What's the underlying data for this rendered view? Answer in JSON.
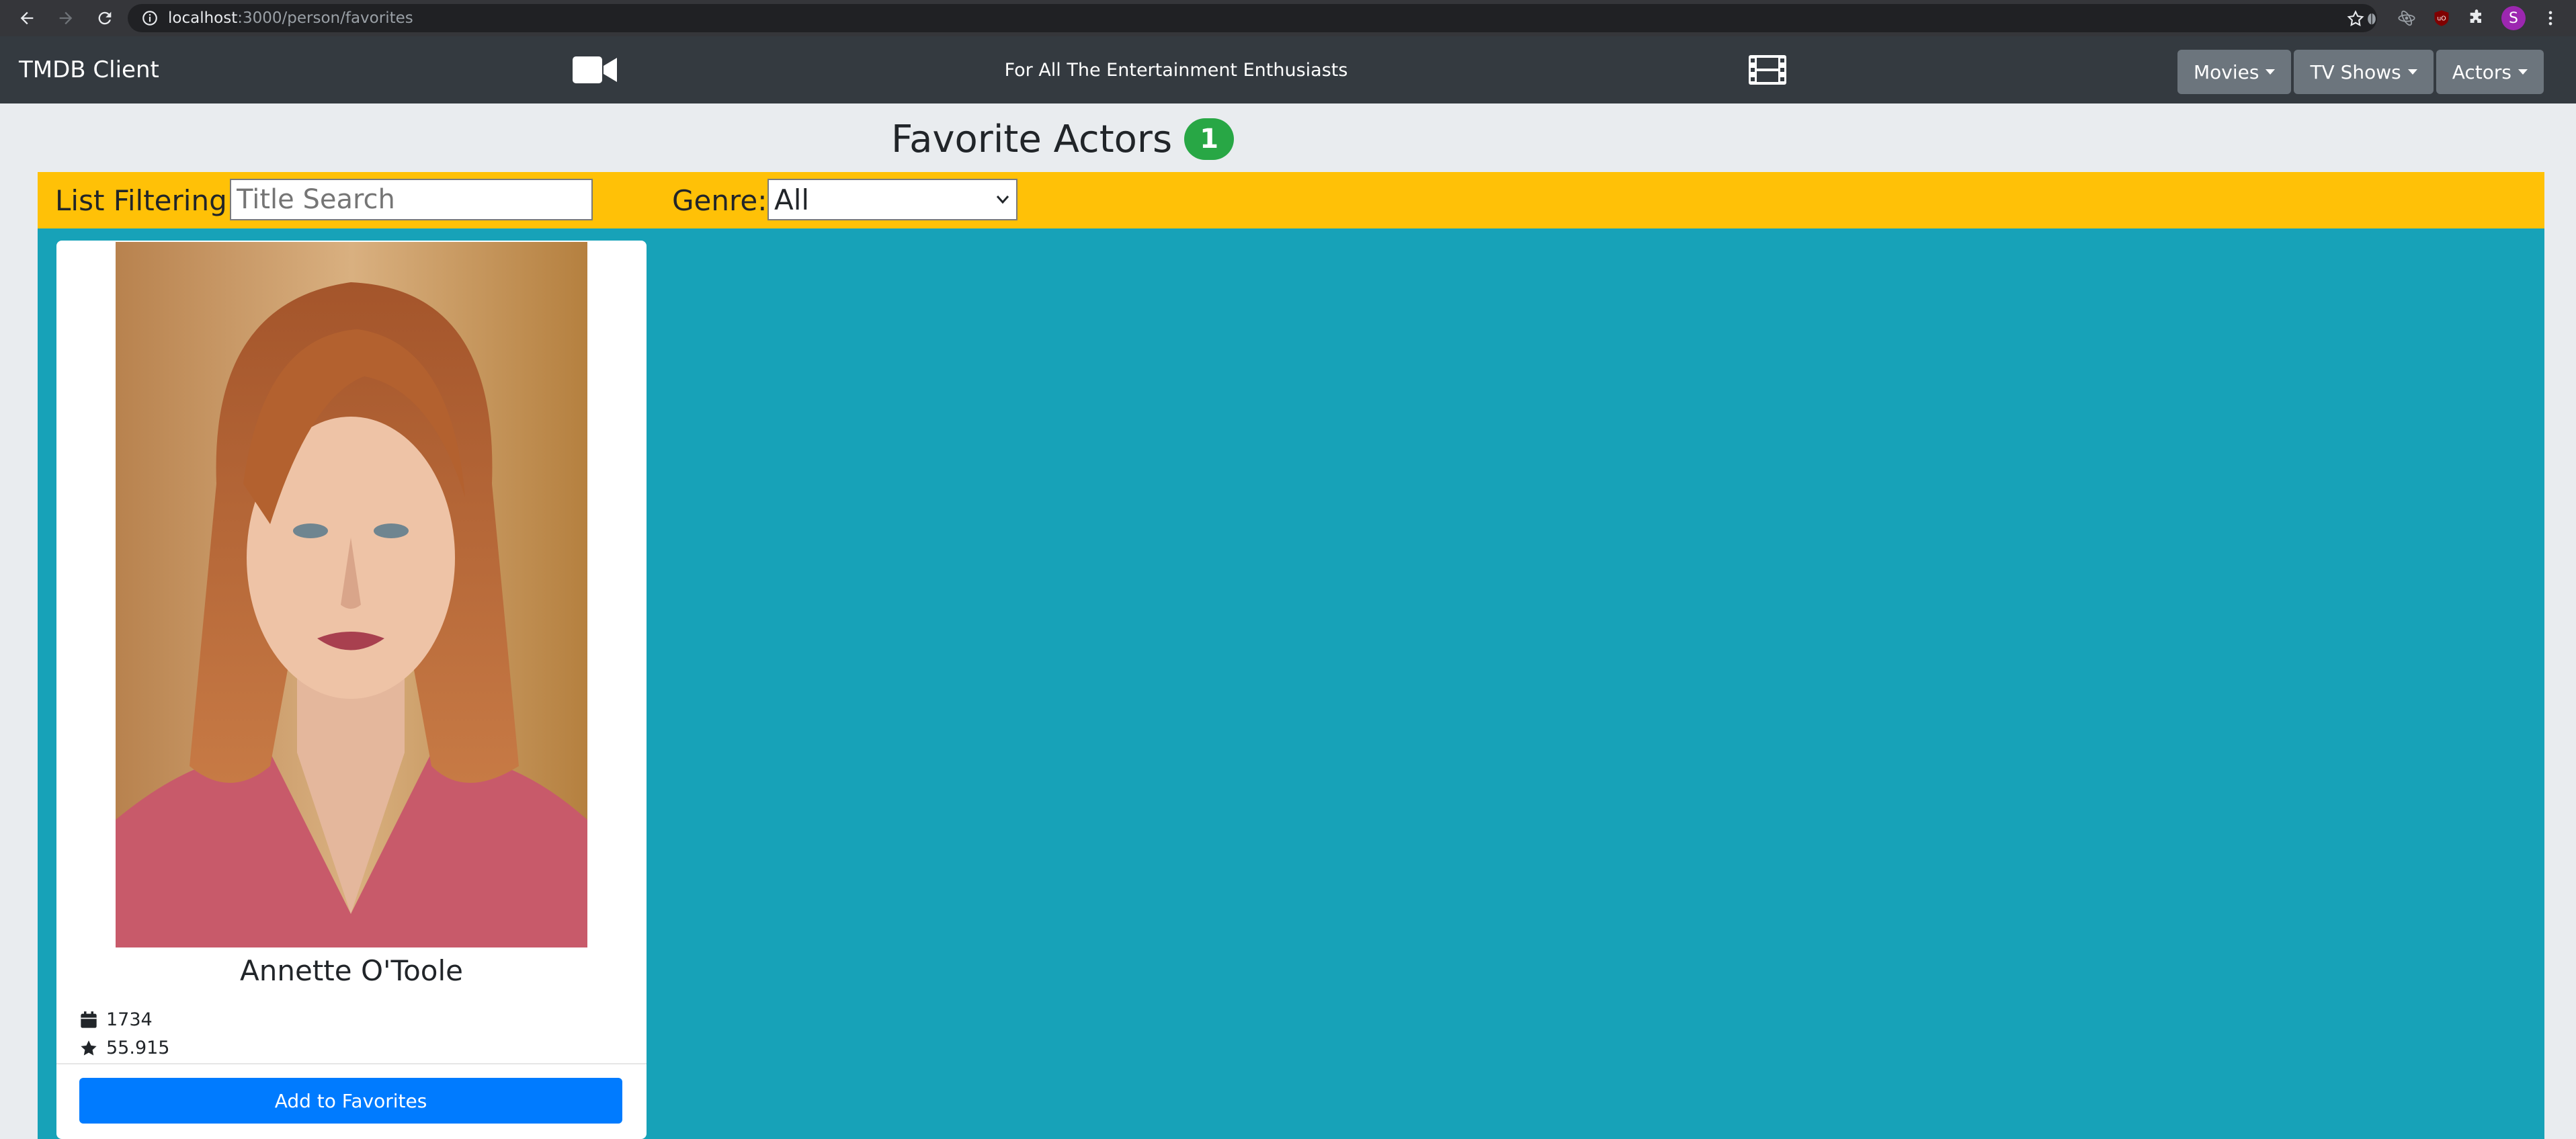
{
  "browser": {
    "url_host": "localhost",
    "url_path": ":3000/person/favorites",
    "profile_initial": "S"
  },
  "navbar": {
    "brand": "TMDB Client",
    "tagline": "For All The Entertainment Enthusiasts",
    "menus": [
      {
        "label": "Movies"
      },
      {
        "label": "TV Shows"
      },
      {
        "label": "Actors"
      }
    ]
  },
  "page": {
    "title": "Favorite Actors",
    "count": "1"
  },
  "filter": {
    "label": "List Filtering:",
    "search_placeholder": "Title Search",
    "genre_label": "Genre:",
    "genre_selected": "All"
  },
  "actor_card": {
    "name": "Annette O'Toole",
    "id_value": "1734",
    "popularity": "55.915",
    "button_label": "Add to Favorites"
  },
  "colors": {
    "navbar": "#343a40",
    "filter_bar": "#ffc107",
    "content_bg": "#17a2b8",
    "badge": "#28a745",
    "primary_button": "#007bff"
  }
}
